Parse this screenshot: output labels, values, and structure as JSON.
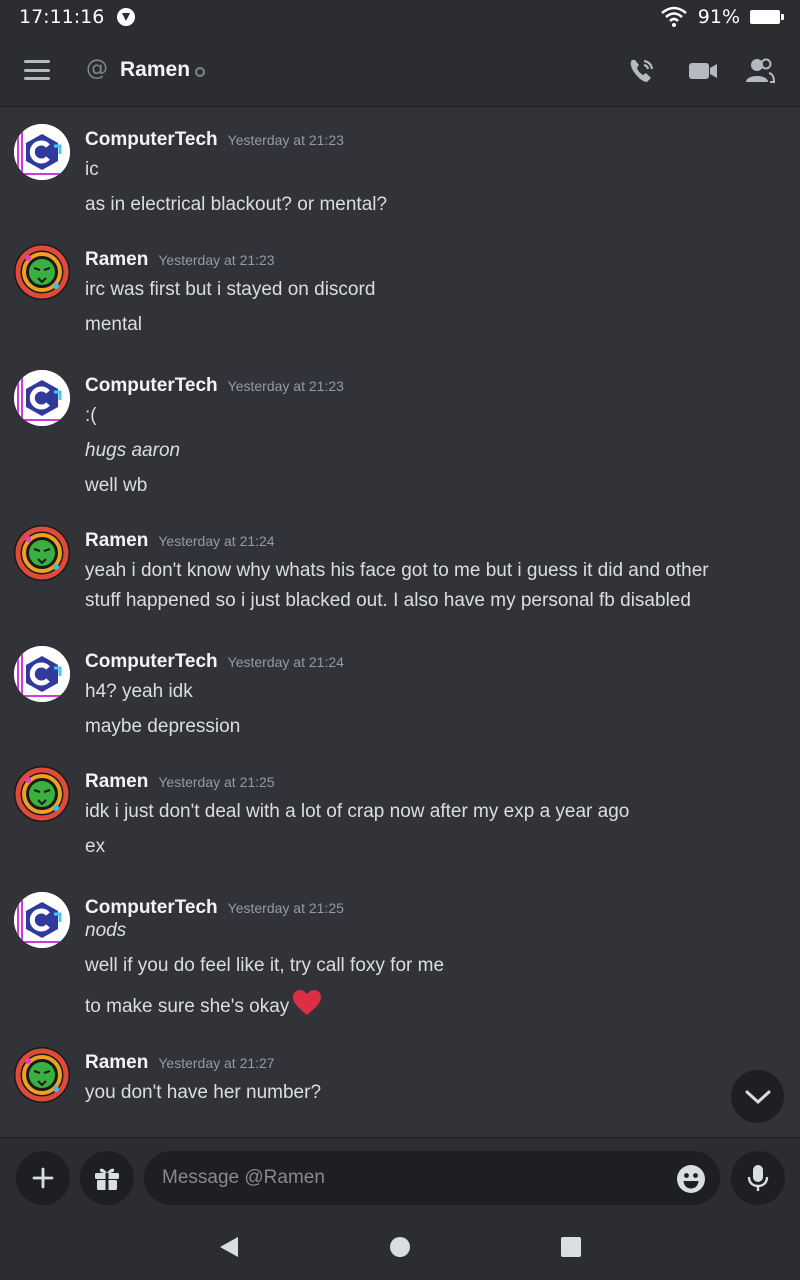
{
  "status_bar": {
    "time": "17:11:16",
    "battery": "91%"
  },
  "header": {
    "title": "Ramen"
  },
  "composer": {
    "placeholder": "Message @Ramen"
  },
  "groups": [
    {
      "author": "ComputerTech",
      "timestamp": "Yesterday at 21:23",
      "avatar": "computertech",
      "lines": [
        {
          "text": "ic"
        },
        {
          "text": "as in electrical blackout? or mental?"
        }
      ]
    },
    {
      "author": "Ramen",
      "timestamp": "Yesterday at 21:23",
      "avatar": "ramen",
      "lines": [
        {
          "text": "irc was first but i stayed on discord"
        },
        {
          "text": "mental"
        }
      ]
    },
    {
      "author": "ComputerTech",
      "timestamp": "Yesterday at 21:23",
      "avatar": "computertech",
      "lines": [
        {
          "text": ":("
        },
        {
          "text": "hugs aaron",
          "italic": true
        },
        {
          "text": "well wb"
        }
      ]
    },
    {
      "author": "Ramen",
      "timestamp": "Yesterday at 21:24",
      "avatar": "ramen",
      "lines": [
        {
          "text": "yeah i don't know why whats his face got to me but i guess it did and other"
        },
        {
          "text": "stuff happened so i just blacked out. I also have my personal fb disabled"
        }
      ]
    },
    {
      "author": "ComputerTech",
      "timestamp": "Yesterday at 21:24",
      "avatar": "computertech",
      "lines": [
        {
          "text": "h4? yeah idk"
        },
        {
          "text": "maybe depression"
        }
      ]
    },
    {
      "author": "Ramen",
      "timestamp": "Yesterday at 21:25",
      "avatar": "ramen",
      "lines": [
        {
          "text": "idk i just don't deal with a lot of crap now after my exp a year ago"
        },
        {
          "text": "ex"
        }
      ]
    },
    {
      "author": "ComputerTech",
      "timestamp": "Yesterday at 21:25",
      "avatar": "computertech",
      "lines": [
        {
          "text": "nods",
          "italic": true
        },
        {
          "text": "well if you do feel like it, try call foxy for me"
        },
        {
          "text": "to make sure she's okay",
          "heart": true
        }
      ]
    },
    {
      "author": "Ramen",
      "timestamp": "Yesterday at 21:27",
      "avatar": "ramen",
      "lines": [
        {
          "text": "you don't have her number?"
        }
      ]
    }
  ]
}
